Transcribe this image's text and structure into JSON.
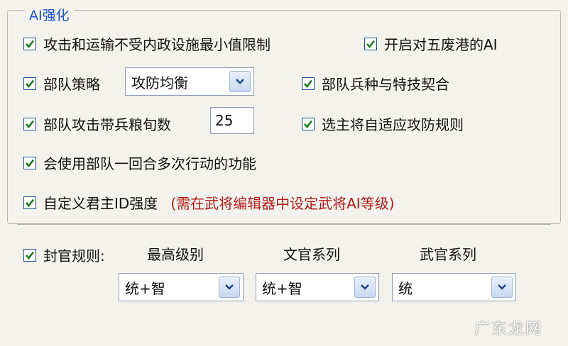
{
  "group": {
    "title": "AI强化"
  },
  "options": {
    "attack_transport": "攻击和运输不受内政设施最小值限制",
    "five_barbarian_ai": "开启对五废港的AI",
    "unit_strategy": "部队策略",
    "unit_strategy_value": "攻防均衡",
    "unit_troop_skill": "部队兵种与特技契合",
    "unit_food_turns": "部队攻击带兵粮旬数",
    "unit_food_turns_value": "25",
    "adaptive_rules": "选主将自适应攻防规则",
    "multi_action": "会使用部队一回合多次行动的功能",
    "custom_lord": "自定义君主ID强度",
    "custom_lord_note": "(需在武将编辑器中设定武将AI等级)"
  },
  "rank": {
    "label": "封官规则:",
    "headers": [
      "最高级别",
      "文官系列",
      "武官系列"
    ],
    "values": [
      "统+智",
      "统+智",
      "统"
    ]
  },
  "watermark": "广东龙网",
  "colors": {
    "check": "#1d7a1d",
    "title": "#1a52c9",
    "note": "#b21d1d"
  }
}
